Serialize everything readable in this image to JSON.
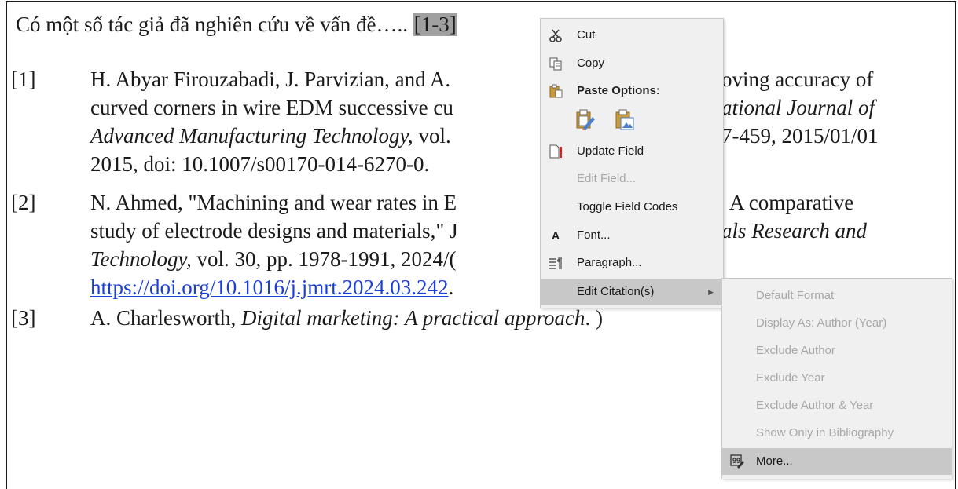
{
  "document": {
    "intro_text": "Có một số tác giả đã nghiên cứu về vấn đề….. ",
    "citation_field": "[1-3]",
    "references": [
      {
        "num": "[1]",
        "lines": [
          "H. Abyar Firouzabadi, J. Parvizian, and A.",
          "curved corners in wire EDM successive cu",
          "Advanced Manufacturing Technology,",
          "2015, doi: 10.1007/s00170-014-6270-0."
        ],
        "line3_suffix": " vol.",
        "tail_line1": "oving accuracy of",
        "tail_line2": "ational Journal of",
        "tail_line3": "7-459, 2015/01/01"
      },
      {
        "num": "[2]",
        "lines": [
          "N. Ahmed, \"Machining and wear rates in E",
          "study of electrode designs and materials,\" J",
          "Technology,",
          "https://doi.org/10.1016/j.jmrt.2024.03.242"
        ],
        "line3_suffix": " vol. 30, pp. 1978-1991, 2024/(",
        "line4_suffix": ".",
        "tail_line1": "A comparative",
        "tail_line2": "als Research and"
      },
      {
        "num": "[3]",
        "prefix": "A. Charlesworth, ",
        "title": "Digital marketing: A practical approach",
        "suffix": ". )"
      }
    ]
  },
  "context_menu": {
    "cut": {
      "label": "Cut",
      "icon": "scissors-icon"
    },
    "copy": {
      "label": "Copy",
      "icon": "copy-icon"
    },
    "paste_options": {
      "label": "Paste Options:",
      "icon": "clipboard-icon"
    },
    "paste_buttons": [
      "keep-source-formatting-icon",
      "picture-paste-icon"
    ],
    "update_field": {
      "label": "Update Field",
      "icon": "update-field-icon"
    },
    "edit_field": {
      "label": "Edit Field...",
      "disabled": true
    },
    "toggle_field_codes": {
      "label": "Toggle Field Codes"
    },
    "font": {
      "label": "Font...",
      "icon": "font-icon"
    },
    "paragraph": {
      "label": "Paragraph...",
      "icon": "paragraph-icon"
    },
    "edit_citation": {
      "label": "Edit Citation(s)",
      "highlighted": true
    }
  },
  "submenu": {
    "items": [
      {
        "label": "Default Format",
        "disabled": true
      },
      {
        "label": "Display As: Author (Year)",
        "disabled": true
      },
      {
        "label": "Exclude Author",
        "disabled": true
      },
      {
        "label": "Exclude Year",
        "disabled": true
      },
      {
        "label": "Exclude Author & Year",
        "disabled": true
      },
      {
        "label": "Show Only in Bibliography",
        "disabled": true
      },
      {
        "label": "More...",
        "highlighted": true,
        "icon": "edit-citation-more-icon"
      }
    ]
  },
  "colors": {
    "link": "#1a3fd6",
    "field_shade": "#a0a0a0",
    "menu_bg": "#f0f0f0",
    "menu_highlight": "#c8c8c8",
    "disabled_text": "#a8a8a8"
  }
}
